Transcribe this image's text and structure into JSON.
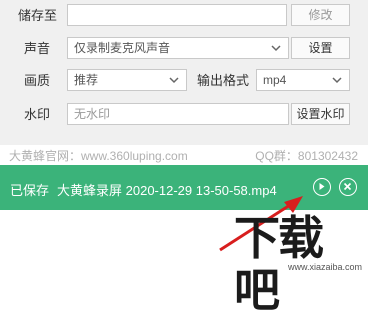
{
  "save_to": {
    "label": "储存至",
    "value": "",
    "button": "修改"
  },
  "audio": {
    "label": "声音",
    "value": "仅录制麦克风声音",
    "button": "设置"
  },
  "quality": {
    "label": "画质",
    "value": "推荐"
  },
  "format": {
    "label": "输出格式",
    "value": "mp4"
  },
  "watermark": {
    "label": "水印",
    "value": "无水印",
    "button": "设置水印"
  },
  "footer": {
    "site": "大黄蜂官网：www.360luping.com",
    "qq": "QQ群：801302432"
  },
  "status_bar": {
    "state": "已保存",
    "filename": "大黄蜂录屏 2020-12-29 13-50-58.mp4",
    "play_icon": "play-icon",
    "close_icon": "close-icon",
    "color": "#3bb37a"
  },
  "logo": {
    "main": "下载吧",
    "url": "www.xiazaiba.com"
  }
}
